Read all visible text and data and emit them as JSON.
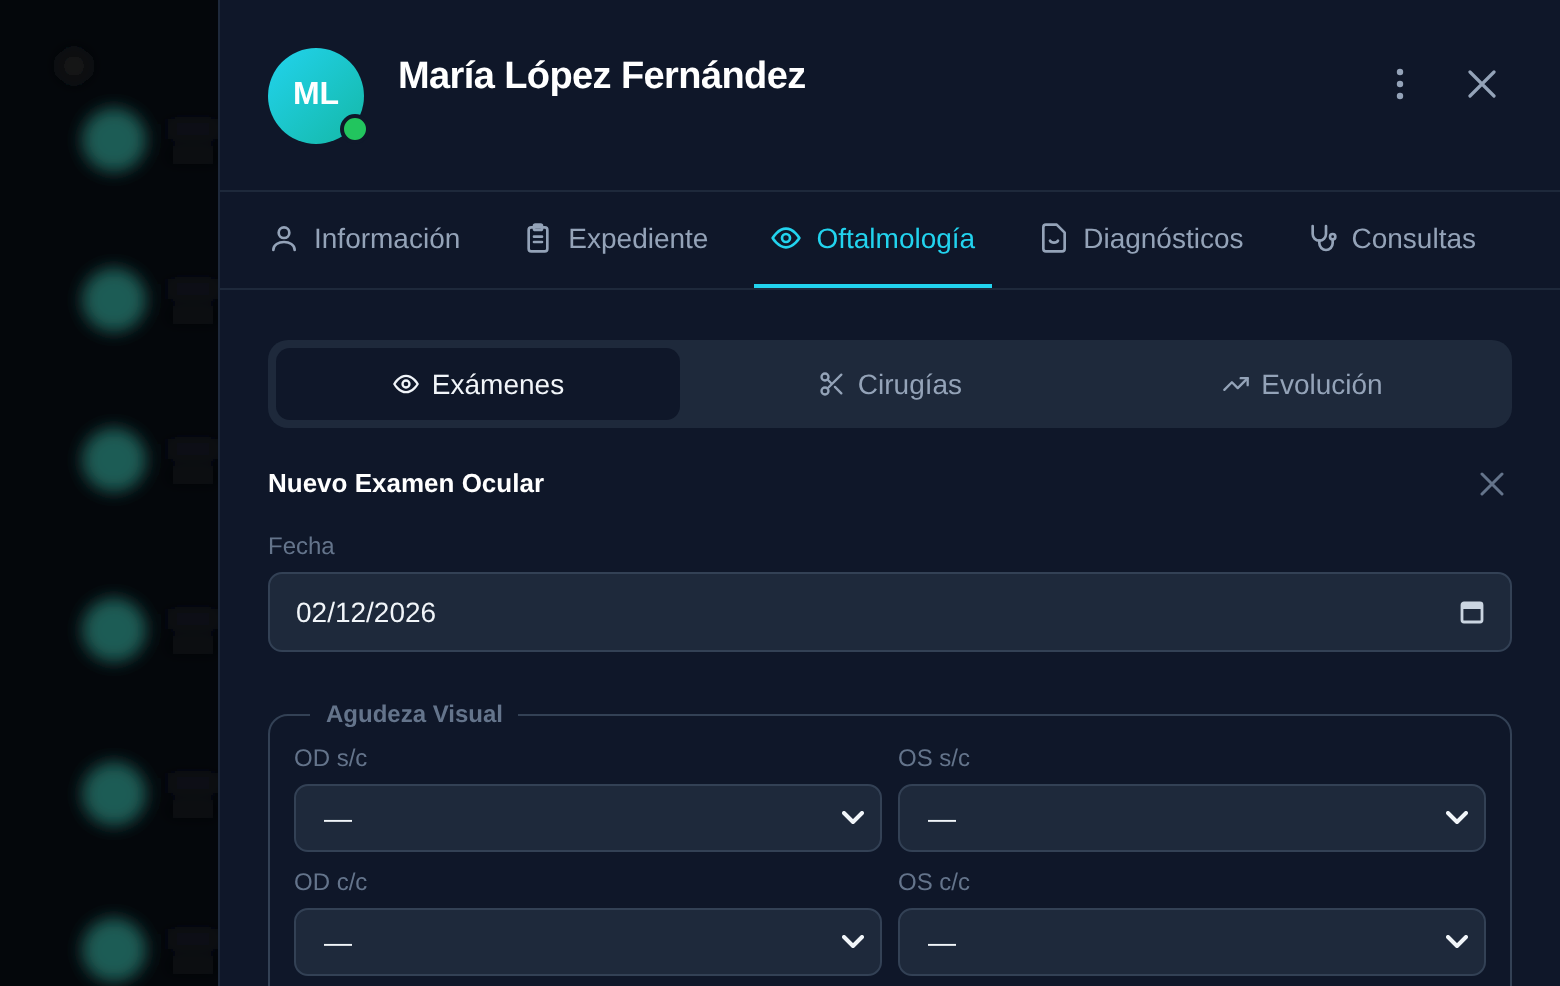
{
  "patient": {
    "initials": "ML",
    "name": "María López Fernández",
    "online": true
  },
  "tabs": [
    {
      "label": "Información",
      "selected": false
    },
    {
      "label": "Expediente",
      "selected": false
    },
    {
      "label": "Oftalmología",
      "selected": true
    },
    {
      "label": "Diagnósticos",
      "selected": false
    },
    {
      "label": "Consultas",
      "selected": false
    }
  ],
  "subtabs": [
    {
      "label": "Exámenes",
      "selected": true
    },
    {
      "label": "Cirugías",
      "selected": false
    },
    {
      "label": "Evolución",
      "selected": false
    }
  ],
  "form": {
    "title": "Nuevo Examen Ocular",
    "date": {
      "label": "Fecha",
      "value": "02/12/2026"
    },
    "group": {
      "legend": "Agudeza Visual",
      "fields": [
        {
          "label": "OD s/c",
          "value": "—"
        },
        {
          "label": "OS s/c",
          "value": "—"
        },
        {
          "label": "OD c/c",
          "value": "—"
        },
        {
          "label": "OS c/c",
          "value": "—"
        }
      ]
    }
  }
}
